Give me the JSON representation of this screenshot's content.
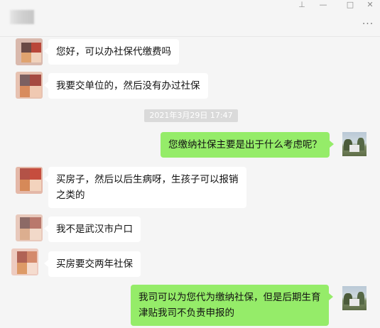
{
  "window": {
    "pin_icon": "pin-icon",
    "minimize_icon": "minimize-icon",
    "maximize_icon": "maximize-icon",
    "close_icon": "close-icon",
    "more_icon": "more-icon"
  },
  "chat": {
    "timestamp": "2021年3月29日 17:47",
    "messages": [
      {
        "side": "in",
        "text": "您好，可以办社保代缴费吗"
      },
      {
        "side": "in",
        "text": "我要交单位的，然后没有办过社保"
      },
      {
        "side": "out",
        "text": "您缴纳社保主要是出于什么考虑呢？"
      },
      {
        "side": "in",
        "text": "买房子，然后以后生病呀，生孩子可以报销\n之类的"
      },
      {
        "side": "in",
        "text": "我不是武汉市户口"
      },
      {
        "side": "in",
        "text": "买房要交两年社保"
      },
      {
        "side": "out",
        "text": "我司可以为您代为缴纳社保，但是后期生育\n津贴我司不负责申报的"
      }
    ]
  },
  "colors": {
    "background": "#f5f5f5",
    "incoming_bubble": "#ffffff",
    "outgoing_bubble": "#95ec69",
    "timestamp_bg": "#dadada"
  }
}
